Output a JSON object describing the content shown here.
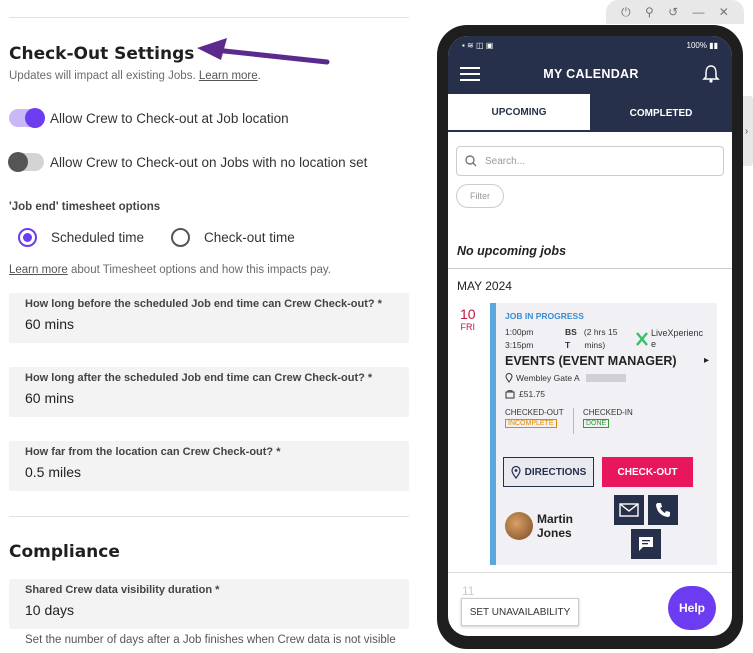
{
  "settings": {
    "checkout_title": "Check-Out Settings",
    "checkout_desc": "Updates will impact all existing Jobs.",
    "learn_more": "Learn more",
    "learn_more_period": ".",
    "toggle1_label": "Allow Crew to Check-out at Job location",
    "toggle1_on": true,
    "toggle2_label": "Allow Crew to Check-out on Jobs with no location set",
    "toggle2_on": false,
    "jobend_label": "'Job end' timesheet options",
    "radio_scheduled": "Scheduled time",
    "radio_checkout": "Check-out time",
    "timesheet_learn_more": "Learn more",
    "timesheet_note": " about Timesheet options and how this impacts pay.",
    "field1_label": "How long before the scheduled Job end time can Crew Check-out? *",
    "field1_value": "60 mins",
    "field2_label": "How long after the scheduled Job end time can Crew Check-out? *",
    "field2_value": "60 mins",
    "field3_label": "How far from the location can Crew Check-out? *",
    "field3_value": "0.5 miles",
    "compliance_title": "Compliance",
    "field4_label": "Shared Crew data visibility duration *",
    "field4_value": "10 days",
    "compliance_note": "Set the number of days after a Job finishes when Crew data is not visible"
  },
  "phone": {
    "status_left": "▪ ≋ ◫ ▣",
    "status_right": "100% ▮▮",
    "app_title": "MY CALENDAR",
    "tab_upcoming": "UPCOMING",
    "tab_completed": "COMPLETED",
    "search_placeholder": "Search...",
    "filter": "Filter",
    "no_upcoming": "No upcoming jobs",
    "month": "MAY 2024",
    "day_num": "10",
    "day_name": "FRI",
    "job_status": "JOB IN PROGRESS",
    "time_start": "1:00pm",
    "time_end": "3:15pm",
    "bs_label": "BS",
    "t_label": "T",
    "duration": "(2 hrs 15",
    "duration2": "mins)",
    "company": "LiveXperienc",
    "company2": "e",
    "event_title": "EVENTS (EVENT MANAGER)",
    "location": "Wembley Gate A",
    "pay": "£51.75",
    "checked_out": "CHECKED-OUT",
    "checked_out_status": "INCOMPLETE",
    "checked_in": "CHECKED-IN",
    "checked_in_status": "DONE",
    "directions": "DIRECTIONS",
    "checkout_btn": "CHECK-OUT",
    "person_first": "Martin",
    "person_last": "Jones",
    "next_day": "11",
    "set_unavailability": "SET UNAVAILABILITY",
    "help": "Help"
  },
  "colors": {
    "accent": "#6c3cf0",
    "navy": "#27304a",
    "checkout_pink": "#e8175d",
    "job_blue": "#5aa7e0",
    "day_red": "#c0143c"
  },
  "icons": [
    "menu-icon",
    "bell-icon",
    "search-icon",
    "pin-icon",
    "pay-icon",
    "mail-icon",
    "phone-icon",
    "chat-icon",
    "power-icon",
    "pin-toolbar-icon",
    "rotate-icon",
    "minimize-icon",
    "close-icon",
    "chevron-right-icon"
  ]
}
